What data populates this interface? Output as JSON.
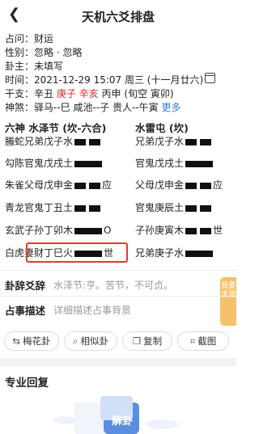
{
  "header": {
    "back_icon": "chevron-left-icon",
    "title": "天机六爻排盘"
  },
  "info": {
    "question_label": "占问：",
    "question": "财运",
    "gender_label": "性别：",
    "gender": "忽略 · 忽略",
    "owner_label": "卦主：",
    "owner": "未填写",
    "time_label": "时间：",
    "time": "2021-12-29 15:07 周三 (十一月廿六)",
    "ganzhi_label": "干支：",
    "ganzhi_year": "辛丑",
    "ganzhi_month": "庚子",
    "ganzhi_day": "辛亥",
    "ganzhi_hour": "丙申",
    "ganzhi_void": "(旬空 寅卯)",
    "shensha_label": "神煞：",
    "shensha": "驿马--巳 咸池--子 贵人--午寅",
    "more": "更多"
  },
  "hexagram": {
    "main_title": "六神  水泽节 (坎-六合)",
    "changed_title": "水雷屯 (坎)",
    "lines": [
      {
        "shen": "螣蛇",
        "main": "兄弟戊子水",
        "type": "yin",
        "mark": "",
        "changed": "兄弟戊子水",
        "ctype": "yin",
        "cmark": ""
      },
      {
        "shen": "勾陈",
        "main": "官鬼戊戌土",
        "type": "yang",
        "mark": "",
        "changed": "官鬼戊戌土",
        "ctype": "yang",
        "cmark": ""
      },
      {
        "shen": "朱雀",
        "main": "父母戊申金",
        "type": "yin",
        "mark": "应",
        "changed": "父母戊申金",
        "ctype": "yin",
        "cmark": "应"
      },
      {
        "shen": "青龙",
        "main": "官鬼丁丑土",
        "type": "yin",
        "mark": "",
        "changed": "官鬼庚辰土",
        "ctype": "yin",
        "cmark": ""
      },
      {
        "shen": "玄武",
        "main": "子孙丁卯木",
        "type": "yang",
        "mark": "O",
        "changed": "子孙庚寅木",
        "ctype": "yin",
        "cmark": "世"
      },
      {
        "shen": "白虎",
        "main": "妻财丁巳火",
        "type": "yang",
        "mark": "世",
        "changed": "兄弟庚子水",
        "ctype": "yang",
        "cmark": ""
      }
    ]
  },
  "interpret": {
    "label": "卦辞爻辞",
    "text": "水泽节:亨。苦节，不可贞。",
    "arrow_icon": "chevron-right-icon"
  },
  "describe": {
    "label": "占事描述",
    "placeholder": "详细描述占事背景"
  },
  "side_tag": "我要求测",
  "buttons": [
    {
      "icon": "swap-icon",
      "label": "梅花卦"
    },
    {
      "icon": "search-icon",
      "label": "相似卦"
    },
    {
      "icon": "copy-icon",
      "label": "复制"
    },
    {
      "icon": "crop-icon",
      "label": "截图"
    }
  ],
  "reply": {
    "title": "专业回复",
    "badge": "解卦"
  },
  "colors": {
    "red": "#d42b2b",
    "blue": "#2f7fd8",
    "highlight": "#e23b2f"
  }
}
